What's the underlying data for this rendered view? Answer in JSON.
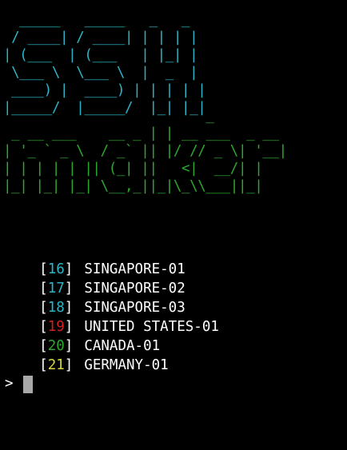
{
  "banner": {
    "ssh_art": "  _____   _____   _   _\n / ____| / ____| | | | |\n| (___  | (___   | |_| |\n \\___ \\  \\___ \\  |  _  |\n ____) |  ____) | | | | |\n|_____/  |_____/  |_| |_|",
    "maker_art": "                         _\n _ __ ___    __ _ | | __ ___  _ __\n| '_ ` _ \\  / _` || |/ // _ \\| '__|\n| | | | | || (_| ||   <|  __/| |\n|_| |_| |_| \\__,_||_|\\_\\\\___||_|"
  },
  "servers": [
    {
      "number": "16",
      "name": "SINGAPORE-01",
      "number_color": "#2bb6c8"
    },
    {
      "number": "17",
      "name": "SINGAPORE-02",
      "number_color": "#2bb6c8"
    },
    {
      "number": "18",
      "name": "SINGAPORE-03",
      "number_color": "#2bb6c8"
    },
    {
      "number": "19",
      "name": "UNITED STATES-01",
      "number_color": "#d42020"
    },
    {
      "number": "20",
      "name": "CANADA-01",
      "number_color": "#2ea82e"
    },
    {
      "number": "21",
      "name": "GERMANY-01",
      "number_color": "#d8d83a"
    }
  ],
  "prompt": {
    "symbol": ">",
    "input_value": ""
  },
  "colors": {
    "background": "#000000",
    "ssh_art": "#2bb6c8",
    "maker_art": "#2ea82e",
    "text": "#ffffff",
    "cursor": "#a8a8a8"
  }
}
